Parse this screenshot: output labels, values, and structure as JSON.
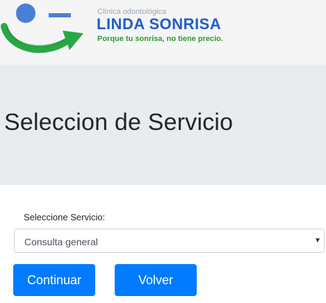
{
  "header": {
    "clinic_type": "Clínica odontológica",
    "brand_name": "LINDA SONRISA",
    "tagline": "Porque tu sonrisa, no tiene precio.",
    "logo_icon": "smile-arrow-logo-icon"
  },
  "jumbotron": {
    "title": "Seleccion de Servicio"
  },
  "form": {
    "service_label": "Seleccione Servicio:",
    "service_selected": "Consulta general"
  },
  "buttons": {
    "continue_label": "Continuar",
    "back_label": "Volver"
  },
  "colors": {
    "primary": "#007bff",
    "brand_blue": "#1e5ec4",
    "brand_green": "#2e9a35",
    "jumbotron_bg": "#e9ecef"
  }
}
